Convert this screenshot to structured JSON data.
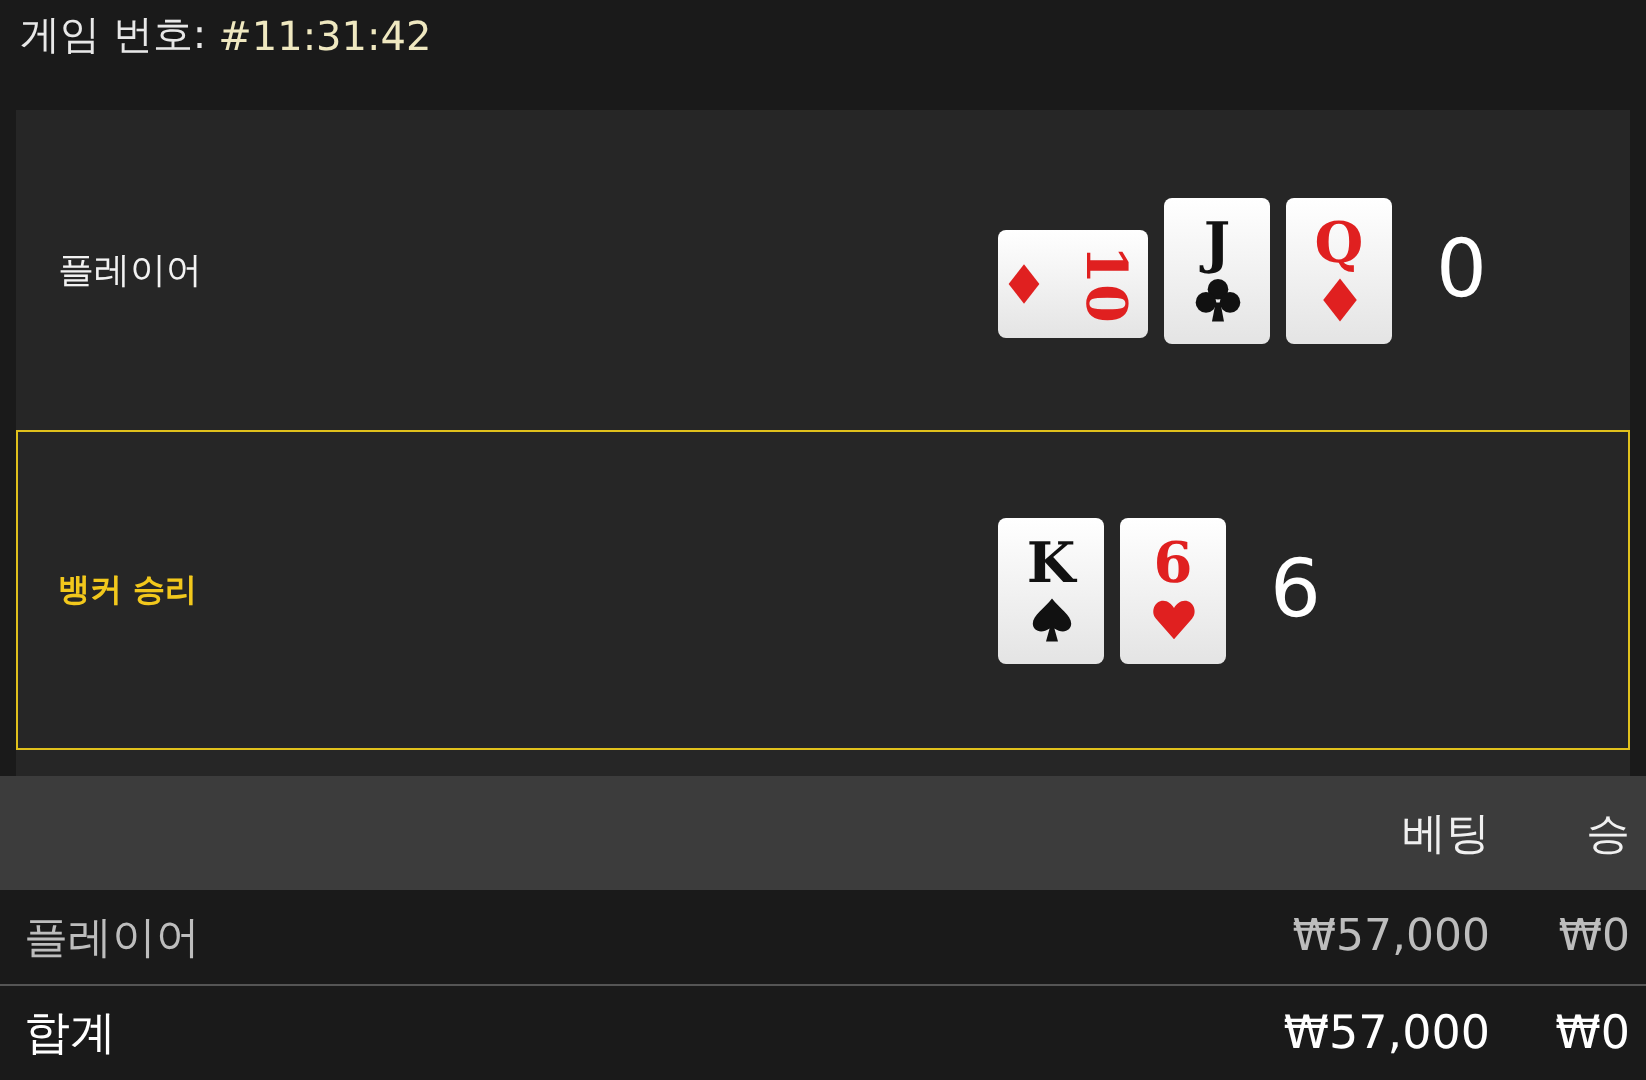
{
  "header": {
    "label": "게임 번호:",
    "game_id": "#11:31:42"
  },
  "hands": [
    {
      "label": "플레이어",
      "winner": false,
      "score": "0",
      "cards": [
        {
          "rank": "10",
          "kind": "diamond",
          "rotated": true
        },
        {
          "rank": "J",
          "kind": "club",
          "rotated": false
        },
        {
          "rank": "Q",
          "kind": "diamond",
          "rotated": false
        }
      ]
    },
    {
      "label": "뱅커 승리",
      "winner": true,
      "score": "6",
      "cards": [
        {
          "rank": "K",
          "kind": "spade",
          "rotated": false
        },
        {
          "rank": "6",
          "kind": "heart",
          "rotated": false
        }
      ]
    }
  ],
  "table": {
    "columns": [
      "베팅",
      "승"
    ],
    "rows": [
      {
        "kind": "bet",
        "label": "플레이어",
        "bet": "₩57,000",
        "win": "₩0"
      },
      {
        "kind": "total",
        "label": "합계",
        "bet": "₩57,000",
        "win": "₩0"
      }
    ]
  }
}
